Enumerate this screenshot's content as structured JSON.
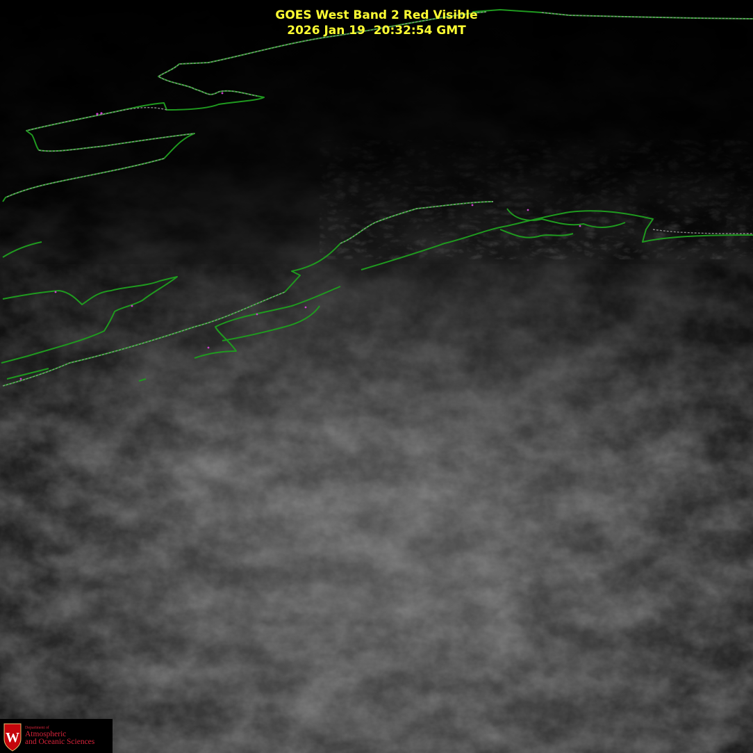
{
  "title": {
    "line1": "GOES West Band 2 Red Visible",
    "line2": "2026 Jan 19  20:32:54 GMT"
  },
  "logo": {
    "crest_letter": "W",
    "dept_label": "Department of",
    "line1": "Atmospheric",
    "line2": "and Oceanic Sciences"
  },
  "colors": {
    "title_text": "#ffff33",
    "coastline": "#1f9a1f",
    "border_line": "#8a8a8a",
    "border_dots": "#d040d0",
    "logo_red": "#c5050c",
    "background": "#000000"
  }
}
